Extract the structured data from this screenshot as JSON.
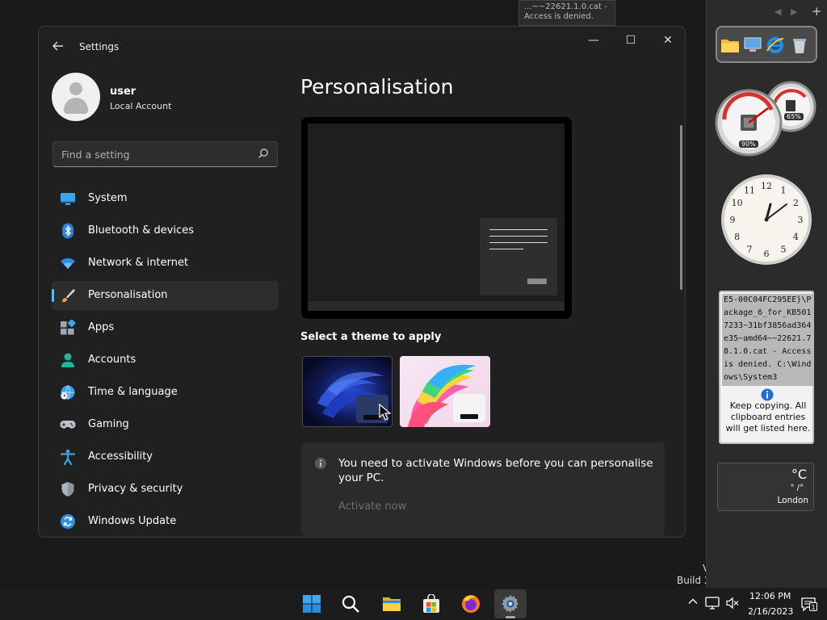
{
  "background": {
    "fragment_text": "...~~22621.1.0.cat - Access is denied.",
    "build_text_line1": "V",
    "build_text_line2": "Build 2"
  },
  "window": {
    "app_title": "Settings",
    "controls": {
      "minimize": "—",
      "maximize": "☐",
      "close": "✕"
    }
  },
  "user": {
    "name": "user",
    "account_type": "Local Account"
  },
  "search": {
    "placeholder": "Find a setting"
  },
  "nav": {
    "items": [
      {
        "label": "System",
        "icon": "monitor-icon"
      },
      {
        "label": "Bluetooth & devices",
        "icon": "bluetooth-icon"
      },
      {
        "label": "Network & internet",
        "icon": "wifi-icon"
      },
      {
        "label": "Personalisation",
        "icon": "paintbrush-icon",
        "active": true
      },
      {
        "label": "Apps",
        "icon": "apps-icon"
      },
      {
        "label": "Accounts",
        "icon": "person-icon"
      },
      {
        "label": "Time & language",
        "icon": "globe-clock-icon"
      },
      {
        "label": "Gaming",
        "icon": "gamepad-icon"
      },
      {
        "label": "Accessibility",
        "icon": "accessibility-icon"
      },
      {
        "label": "Privacy & security",
        "icon": "shield-icon"
      },
      {
        "label": "Windows Update",
        "icon": "refresh-icon"
      }
    ]
  },
  "content": {
    "title": "Personalisation",
    "theme_section_label": "Select a theme to apply",
    "themes": [
      "windows-bloom-dark",
      "windows-bloom-colorful"
    ],
    "notice": {
      "message": "You need to activate Windows before you can personalise your PC.",
      "action": "Activate now"
    }
  },
  "gadgets": {
    "cpu_meter": {
      "cpu": "90%",
      "memory": "65%"
    },
    "clock": {
      "hour_numbers": [
        "12",
        "1",
        "2",
        "3",
        "4",
        "5",
        "6",
        "7",
        "8",
        "9",
        "10",
        "11"
      ]
    },
    "clipboard": {
      "entry": "E5-00C04FC295EE}\\Package_6_for_KB5017233~31bf3856ad364e35~amd64~~22621.78.1.0.cat - Access is denied. C:\\Windows\\System3",
      "hint": "Keep copying. All clipboard entries will get listed here."
    },
    "weather": {
      "temp": "°C",
      "range": "° /°",
      "city": "London"
    }
  },
  "taskbar": {
    "apps": [
      "windows-start-icon",
      "search-icon",
      "file-explorer-icon",
      "store-icon",
      "firefox-icon",
      "settings-icon"
    ],
    "time": "12:06 PM",
    "date": "2/16/2023",
    "notification_count": "1"
  },
  "colors": {
    "accent": "#4cc2ff",
    "window_bg": "#202020",
    "notice_bg": "#2b2b2b"
  }
}
